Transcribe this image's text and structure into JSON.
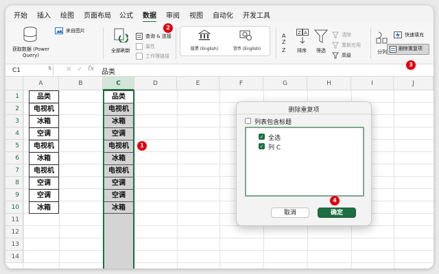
{
  "tabs": [
    "开始",
    "插入",
    "绘图",
    "页面布局",
    "公式",
    "数据",
    "审阅",
    "视图",
    "自动化",
    "开发工具"
  ],
  "active_tab": "数据",
  "ribbon": {
    "get_data": "获取数据 (Power Query)",
    "from_picture": "来自图片",
    "refresh_all": "全部刷新",
    "queries_connections": "查询 & 连接",
    "properties": "属性",
    "workbook_links": "工作簿链接",
    "stocks": "股票 (English)",
    "currencies": "货币 (English)",
    "sort": "排序",
    "filter": "筛选",
    "clear": "清除",
    "reapply": "重新应用",
    "advanced": "高级",
    "text_to_columns": "分列",
    "flash_fill": "快速填充",
    "remove_duplicates": "删除重复项"
  },
  "formula_bar": {
    "name_box": "C1",
    "fx": "fx",
    "value": "品类"
  },
  "columns": [
    "A",
    "B",
    "C",
    "D",
    "E",
    "F",
    "G",
    "H",
    "I",
    "J"
  ],
  "rows": [
    "1",
    "2",
    "3",
    "4",
    "5",
    "6",
    "7",
    "8",
    "9",
    "10",
    "11",
    "12",
    "13",
    "14"
  ],
  "col_a": [
    "品类",
    "电视机",
    "冰箱",
    "空调",
    "电视机",
    "冰箱",
    "电视机",
    "空调",
    "空调",
    "冰箱"
  ],
  "col_c": [
    "品类",
    "电视机",
    "冰箱",
    "空调",
    "电视机",
    "冰箱",
    "电视机",
    "空调",
    "空调",
    "冰箱"
  ],
  "dialog": {
    "title": "删除重复项",
    "header_checkbox": "列表包含标题",
    "select_all": "全选",
    "column_item": "列 C",
    "cancel": "取消",
    "ok": "确定"
  },
  "badges": [
    "1",
    "2",
    "3",
    "4"
  ],
  "colors": {
    "excel_green": "#1d6f42",
    "badge_red": "#e00010"
  }
}
